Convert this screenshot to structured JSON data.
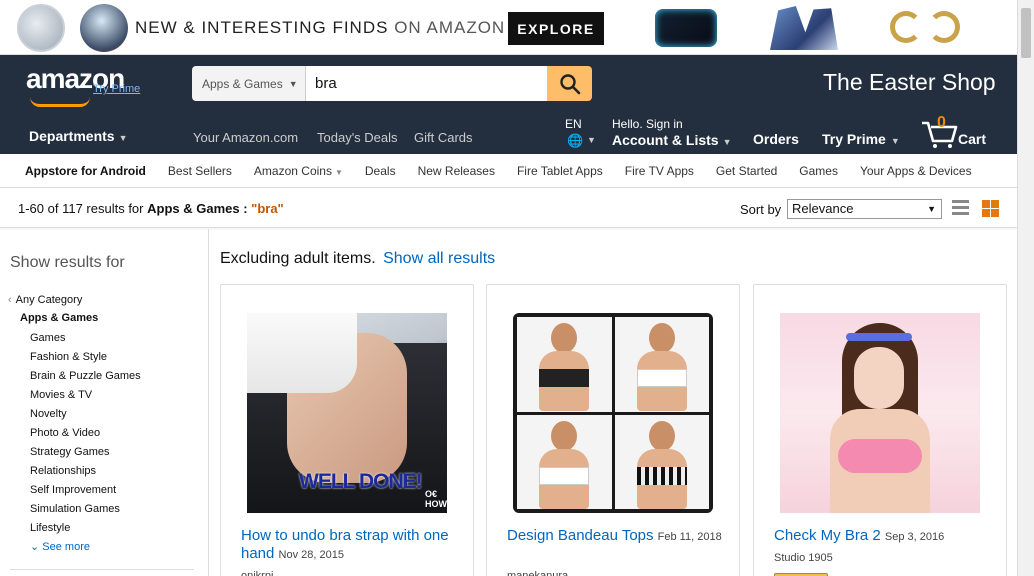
{
  "promo": {
    "text_bold": "NEW & INTERESTING FINDS",
    "text_light": "ON AMAZON",
    "explore": "EXPLORE"
  },
  "nav": {
    "logo": "amazon",
    "try_prime_small": "Try Prime",
    "search": {
      "category": "Apps & Games",
      "value": "bra"
    },
    "easter": "The Easter Shop",
    "departments": "Departments",
    "links": [
      "Your Amazon.com",
      "Today's Deals",
      "Gift Cards"
    ],
    "lang": "EN",
    "hello": "Hello. Sign in",
    "account": "Account & Lists",
    "orders": "Orders",
    "try_prime": "Try Prime",
    "cart_count": "0",
    "cart": "Cart"
  },
  "subnav": [
    "Appstore for Android",
    "Best Sellers",
    "Amazon Coins",
    "Deals",
    "New Releases",
    "Fire Tablet Apps",
    "Fire TV Apps",
    "Get Started",
    "Games",
    "Your Apps & Devices"
  ],
  "results": {
    "range": "1-60 of 117 results for ",
    "category": "Apps & Games",
    "sep": " : ",
    "query": "\"bra\"",
    "sort_label": "Sort by",
    "sort_value": "Relevance"
  },
  "sidebar": {
    "heading": "Show results for",
    "any": "Any Category",
    "current": "Apps & Games",
    "items": [
      "Games",
      "Fashion & Style",
      "Brain & Puzzle Games",
      "Movies & TV",
      "Novelty",
      "Photo & Video",
      "Strategy Games",
      "Relationships",
      "Self Improvement",
      "Simulation Games",
      "Lifestyle"
    ],
    "see_more": "See more"
  },
  "main": {
    "excluding": "Excluding adult items.",
    "show_all": "Show all results",
    "products": [
      {
        "title": "How to undo bra strap with one hand",
        "date": "Nov 28, 2015",
        "publisher": "onikrpi",
        "overlay": "WELL DONE!",
        "overlay_brand": "O€ HOWTO"
      },
      {
        "title": "Design Bandeau Tops",
        "date": "Feb 11, 2018",
        "publisher": "manekanura"
      },
      {
        "title": "Check My Bra 2",
        "date": "Sep 3, 2016",
        "publisher": "Studio 1905"
      }
    ]
  },
  "colors": {
    "nav_bg": "#232f3e",
    "accent_orange": "#febd69",
    "link_blue": "#0066c0",
    "query_orange": "#c45500"
  }
}
